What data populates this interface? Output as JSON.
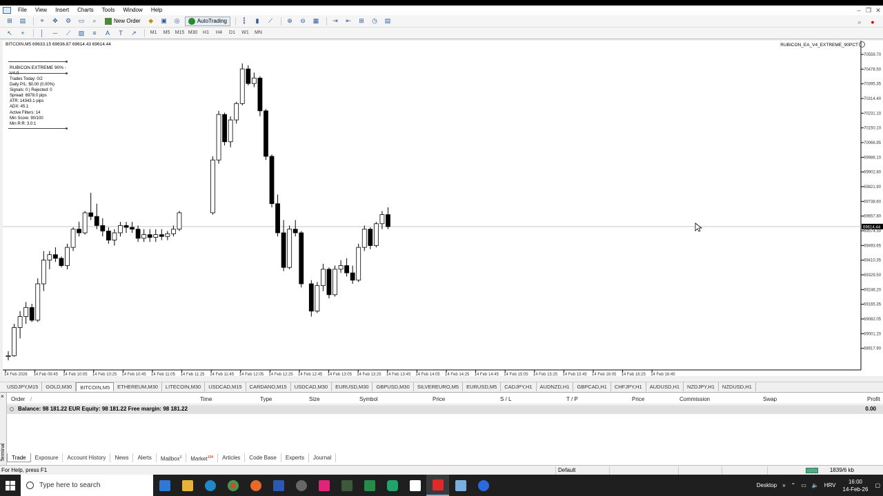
{
  "menu": [
    "File",
    "View",
    "Insert",
    "Charts",
    "Tools",
    "Window",
    "Help"
  ],
  "toolbar": {
    "new_order": "New Order",
    "autotrading": "AutoTrading"
  },
  "timeframes": [
    "M1",
    "M5",
    "M15",
    "M30",
    "H1",
    "H4",
    "D1",
    "W1",
    "MN"
  ],
  "chart": {
    "symbol_info": "BITCOIN,M5  69633.15 69636.87 69614.43 69614.44",
    "ea_name": "RUBICON_EA_V4_EXTREME_90PCT",
    "panel": {
      "title": "RUBICON EXTREME 90% - V4.0",
      "lines": [
        "Trades Today: 0/2",
        "Daily P/L: $0.00 (0.00%)",
        "Signals: 0 | Rejected: 0",
        "Spread: 6978.0 pips",
        "ATR: 14343.1 pips",
        "ADX: 45.1",
        "Active Filters: 14",
        "Min Score: 90/100",
        "Min R:R: 3.0:1"
      ]
    },
    "current_price": "69614.44",
    "price_ticks": [
      "70559.70",
      "70478.50",
      "70395.35",
      "70314.40",
      "70231.10",
      "70150.10",
      "70066.95",
      "69986.10",
      "69902.80",
      "69821.90",
      "69738.60",
      "69657.80",
      "69574.50",
      "69493.65",
      "69410.35",
      "69329.50",
      "69246.20",
      "69165.35",
      "69082.05",
      "69001.20",
      "68917.90"
    ],
    "time_ticks": [
      "14 Feb 2026",
      "14 Feb 09:45",
      "14 Feb 10:05",
      "14 Feb 10:25",
      "14 Feb 10:45",
      "14 Feb 11:05",
      "14 Feb 11:25",
      "14 Feb 11:45",
      "14 Feb 12:05",
      "14 Feb 12:25",
      "14 Feb 12:45",
      "14 Feb 13:05",
      "14 Feb 13:25",
      "14 Feb 13:45",
      "14 Feb 14:05",
      "14 Feb 14:25",
      "14 Feb 14:45",
      "14 Feb 15:05",
      "14 Feb 15:25",
      "14 Feb 15:45",
      "14 Feb 16:05",
      "14 Feb 16:25",
      "14 Feb 16:45"
    ]
  },
  "chart_data": {
    "type": "candlestick",
    "ohlc": [
      [
        68900,
        68930,
        68880,
        68905
      ],
      [
        68905,
        69080,
        68900,
        69060
      ],
      [
        69060,
        69150,
        69000,
        69120
      ],
      [
        69120,
        69200,
        69080,
        69170
      ],
      [
        69170,
        69190,
        69090,
        69100
      ],
      [
        69100,
        69330,
        69090,
        69300
      ],
      [
        69300,
        69480,
        69260,
        69430
      ],
      [
        69430,
        69480,
        69380,
        69460
      ],
      [
        69460,
        69500,
        69420,
        69440
      ],
      [
        69440,
        69450,
        69390,
        69400
      ],
      [
        69400,
        69520,
        69380,
        69500
      ],
      [
        69500,
        69610,
        69480,
        69600
      ],
      [
        69600,
        69640,
        69560,
        69580
      ],
      [
        69580,
        69700,
        69570,
        69690
      ],
      [
        69690,
        69800,
        69650,
        69670
      ],
      [
        69670,
        69740,
        69600,
        69620
      ],
      [
        69620,
        69660,
        69560,
        69590
      ],
      [
        69590,
        69610,
        69520,
        69540
      ],
      [
        69540,
        69600,
        69510,
        69580
      ],
      [
        69580,
        69640,
        69560,
        69620
      ],
      [
        69620,
        69640,
        69580,
        69610
      ],
      [
        69610,
        69640,
        69580,
        69600
      ],
      [
        69600,
        69620,
        69530,
        69550
      ],
      [
        69550,
        69600,
        69530,
        69570
      ],
      [
        69570,
        69600,
        69530,
        69555
      ],
      [
        69555,
        69600,
        69530,
        69570
      ],
      [
        69570,
        69600,
        69540,
        69560
      ],
      [
        69560,
        69590,
        69540,
        69575
      ],
      [
        69575,
        69620,
        69560,
        69600
      ],
      [
        69600,
        69700,
        69590,
        69690
      ],
      [
        69690,
        70000,
        69680,
        69980
      ],
      [
        69980,
        70250,
        69960,
        70230
      ],
      [
        70230,
        70240,
        70060,
        70080
      ],
      [
        70080,
        70220,
        70050,
        70200
      ],
      [
        70200,
        70300,
        70180,
        70290
      ],
      [
        70290,
        70510,
        70280,
        70480
      ],
      [
        70480,
        70500,
        70390,
        70400
      ],
      [
        70400,
        70460,
        70380,
        70430
      ],
      [
        70430,
        70440,
        70220,
        70250
      ],
      [
        70250,
        70260,
        69980,
        70000
      ],
      [
        70000,
        70010,
        69720,
        69740
      ],
      [
        69740,
        69790,
        69560,
        69580
      ],
      [
        69580,
        69650,
        69370,
        69390
      ],
      [
        69390,
        69620,
        69380,
        69600
      ],
      [
        69600,
        69650,
        69560,
        69580
      ],
      [
        69580,
        69590,
        69280,
        69300
      ],
      [
        69300,
        69320,
        69120,
        69150
      ],
      [
        69150,
        69310,
        69140,
        69290
      ],
      [
        69290,
        69410,
        69260,
        69380
      ],
      [
        69380,
        69390,
        69220,
        69240
      ],
      [
        69240,
        69400,
        69230,
        69380
      ],
      [
        69380,
        69430,
        69360,
        69400
      ],
      [
        69400,
        69440,
        69340,
        69360
      ],
      [
        69360,
        69400,
        69300,
        69320
      ],
      [
        69320,
        69520,
        69310,
        69500
      ],
      [
        69500,
        69620,
        69480,
        69600
      ],
      [
        69600,
        69610,
        69490,
        69510
      ],
      [
        69510,
        69640,
        69500,
        69630
      ],
      [
        69630,
        69700,
        69600,
        69680
      ],
      [
        69680,
        69720,
        69600,
        69614
      ]
    ],
    "ylim": [
      68880,
      70590
    ]
  },
  "symbol_tabs": [
    "USDJPY,M15",
    "GOLD,M30",
    "BITCOIN,M5",
    "ETHEREUM,M30",
    "LITECOIN,M30",
    "USDCAD,M15",
    "CARDANO,M15",
    "USDCAD,M30",
    "EURUSD,M30",
    "GBPUSD,M30",
    "SILVEREURO,M5",
    "EURUSD,M5",
    "CADJPY,H1",
    "AUDNZD,H1",
    "GBPCAD,H1",
    "CHFJPY,H1",
    "AUDUSD,H1",
    "NZDJPY,H1",
    "NZDUSD,H1"
  ],
  "terminal": {
    "side_label": "Terminal",
    "columns": [
      "Order",
      "Time",
      "Type",
      "Size",
      "Symbol",
      "Price",
      "S / L",
      "T / P",
      "Price",
      "Commission",
      "Swap",
      "Profit"
    ],
    "balance": "Balance: 98 181.22 EUR  Equity: 98 181.22  Free margin: 98 181.22",
    "profit": "0.00",
    "tabs": [
      "Trade",
      "Exposure",
      "Account History",
      "News",
      "Alerts",
      "Mailbox",
      "Market",
      "Articles",
      "Code Base",
      "Experts",
      "Journal"
    ],
    "mailbox_badge": "3",
    "market_badge": "104"
  },
  "status": {
    "help": "For Help, press F1",
    "profile": "Default",
    "traffic": "1839/6 kb"
  },
  "taskbar": {
    "search_placeholder": "Type here to search",
    "tray_desktop": "Desktop",
    "lang": "HRV",
    "time": "16:00",
    "date": "14-Feb-26"
  }
}
